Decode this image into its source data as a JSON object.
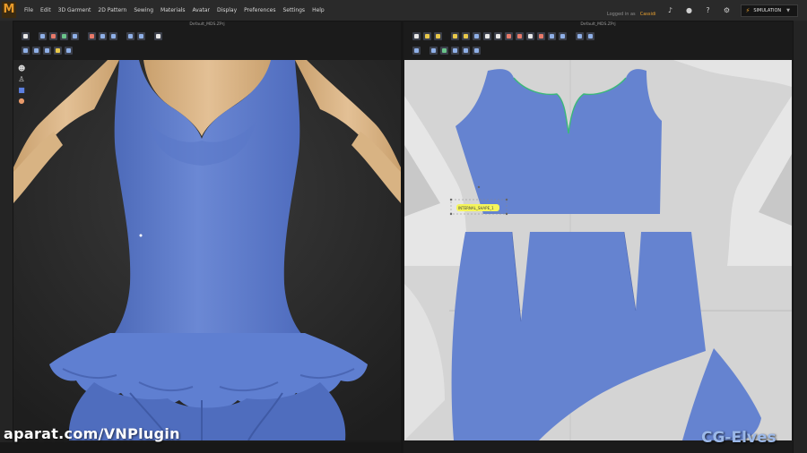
{
  "app": {
    "logo_letter": "M"
  },
  "menu": [
    "File",
    "Edit",
    "3D Garment",
    "2D Pattern",
    "Sewing",
    "Materials",
    "Avatar",
    "Display",
    "Preferences",
    "Settings",
    "Help"
  ],
  "user": {
    "label": "Logged in as",
    "name": "Cassidi"
  },
  "status_icons": [
    "sound-icon",
    "user-icon",
    "help-icon",
    "gear-icon"
  ],
  "simulation": {
    "label": "SIMULATION",
    "icon": "bolt-icon",
    "accent": "#e8a030"
  },
  "panes": {
    "left_title": "Default_MDS.ZPrj",
    "right_title": "Default_MDS.ZPrj"
  },
  "left_toolbar_icons": [
    "select-icon",
    "move-icon",
    "garment-icon",
    "avatar-icon",
    "fold-icon",
    "arrange-icon",
    "fit-icon",
    "pin-icon",
    "tack-icon",
    "measure-icon"
  ],
  "right_toolbar_icons": [
    "transform-icon",
    "edit-point-icon",
    "curve-icon",
    "add-point-icon",
    "cut-icon",
    "rectangle-icon",
    "polygon-icon",
    "circle-icon",
    "internal-icon",
    "dart-icon",
    "segment-sew-icon",
    "free-sew-icon",
    "notch-icon",
    "trace-icon"
  ],
  "view_controls": [
    "avatar-view-icon",
    "figure-icon",
    "garment-view-icon",
    "skin-icon"
  ],
  "colors": {
    "fabric": "#6583d0",
    "fabric_shadow": "#4c69b8",
    "skin": "#dcb88a",
    "pattern_canvas": "#d4d4d4",
    "selected_seam": "#3bb87a",
    "highlight": "#f5f55a"
  },
  "pattern_label": "INTERNAL_SHAPE_1",
  "watermark": "aparat.com/VNPlugin",
  "brand": "CG-Elves"
}
